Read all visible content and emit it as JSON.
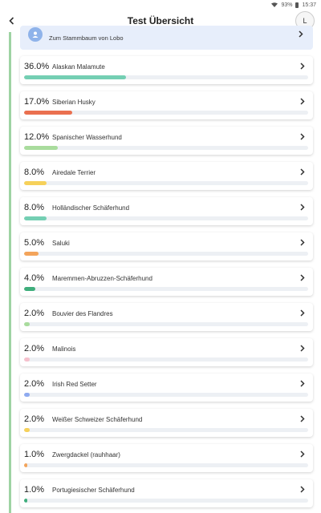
{
  "status": {
    "battery": "93%",
    "time": "15:37"
  },
  "header": {
    "title": "Test Übersicht",
    "avatar_letter": "L"
  },
  "stammbaum": {
    "label": "Zum Stammbaum von Lobo"
  },
  "breeds": [
    {
      "pct": "36.0%",
      "value": 36.0,
      "name": "Alaskan Malamute",
      "color": "#74cfb3"
    },
    {
      "pct": "17.0%",
      "value": 17.0,
      "name": "Siberian Husky",
      "color": "#ea7050"
    },
    {
      "pct": "12.0%",
      "value": 12.0,
      "name": "Spanischer Wasserhund",
      "color": "#a9dc9d"
    },
    {
      "pct": "8.0%",
      "value": 8.0,
      "name": "Airedale Terrier",
      "color": "#f6d15a"
    },
    {
      "pct": "8.0%",
      "value": 8.0,
      "name": "Holländischer Schäferhund",
      "color": "#74cfb3"
    },
    {
      "pct": "5.0%",
      "value": 5.0,
      "name": "Saluki",
      "color": "#f3a45b"
    },
    {
      "pct": "4.0%",
      "value": 4.0,
      "name": "Maremmen-Abruzzen-Schäferhund",
      "color": "#3fae7c"
    },
    {
      "pct": "2.0%",
      "value": 2.0,
      "name": "Bouvier des Flandres",
      "color": "#a9dc9d"
    },
    {
      "pct": "2.0%",
      "value": 2.0,
      "name": "Malinois",
      "color": "#f6c1cd"
    },
    {
      "pct": "2.0%",
      "value": 2.0,
      "name": "Irish Red Setter",
      "color": "#8eaaf0"
    },
    {
      "pct": "2.0%",
      "value": 2.0,
      "name": "Weißer Schweizer Schäferhund",
      "color": "#f6d15a"
    },
    {
      "pct": "1.0%",
      "value": 1.0,
      "name": "Zwergdackel (rauhhaar)",
      "color": "#f3a45b"
    },
    {
      "pct": "1.0%",
      "value": 1.0,
      "name": "Portugiesischer Schäferhund",
      "color": "#3fae7c"
    }
  ]
}
